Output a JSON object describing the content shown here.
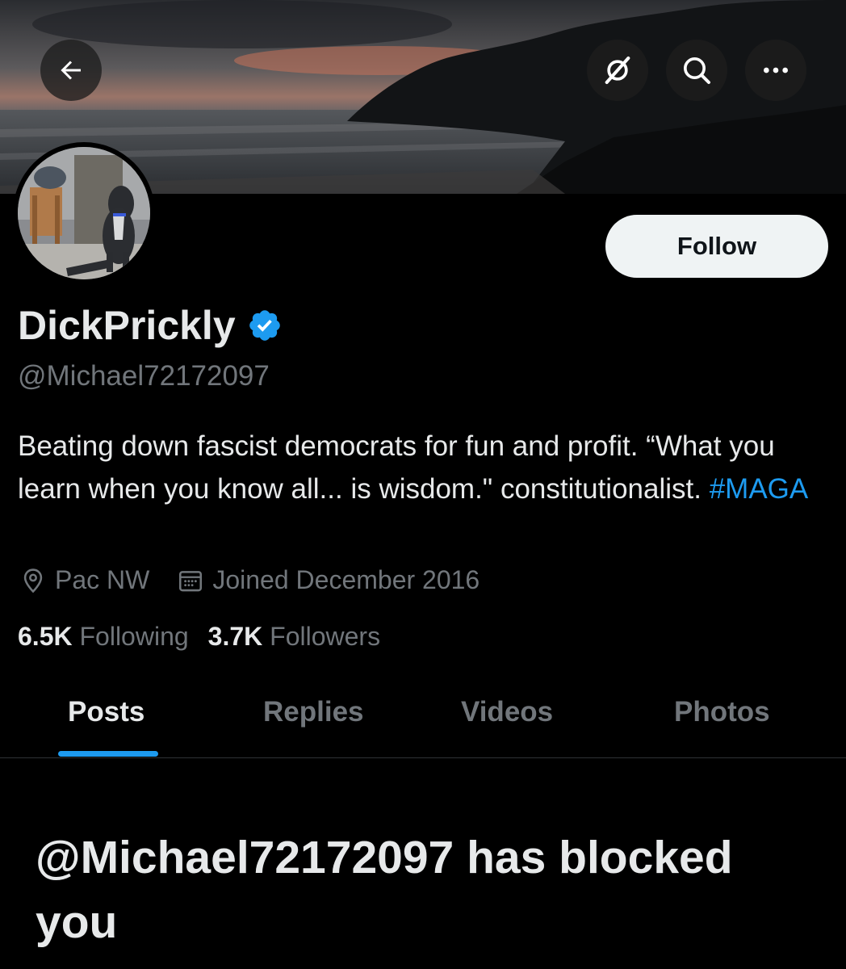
{
  "header": {
    "back_icon": "arrow-left-icon",
    "grok_icon": "grok-icon",
    "search_icon": "search-icon",
    "more_icon": "more-horizontal-icon"
  },
  "profile": {
    "display_name": "DickPrickly",
    "verified": true,
    "handle": "@Michael72172097",
    "follow_label": "Follow",
    "bio_text": "Beating down fascist democrats for fun and profit. “What you learn when you know all... is wisdom.\" constitutionalist. ",
    "bio_hashtag": "#MAGA",
    "location": "Pac NW",
    "joined": "Joined December 2016",
    "following_count": "6.5K",
    "following_label": "Following",
    "followers_count": "3.7K",
    "followers_label": "Followers"
  },
  "tabs": [
    {
      "label": "Posts",
      "active": true
    },
    {
      "label": "Replies",
      "active": false
    },
    {
      "label": "Videos",
      "active": false
    },
    {
      "label": "Photos",
      "active": false
    }
  ],
  "blocked_message": "@Michael72172097 has blocked you",
  "colors": {
    "accent": "#1d9bf0",
    "background": "#000000",
    "muted_text": "#71767b",
    "primary_text": "#e7e9ea"
  }
}
